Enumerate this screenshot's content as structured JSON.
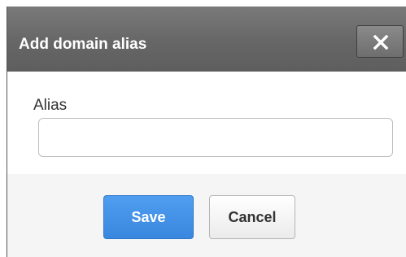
{
  "dialog": {
    "title": "Add domain alias",
    "close_icon": "close-icon"
  },
  "form": {
    "alias_label": "Alias",
    "alias_value": "",
    "alias_placeholder": ""
  },
  "actions": {
    "save_label": "Save",
    "cancel_label": "Cancel"
  },
  "colors": {
    "titlebar": "#666666",
    "save_button": "#3a87df",
    "footer": "#f5f5f5"
  }
}
